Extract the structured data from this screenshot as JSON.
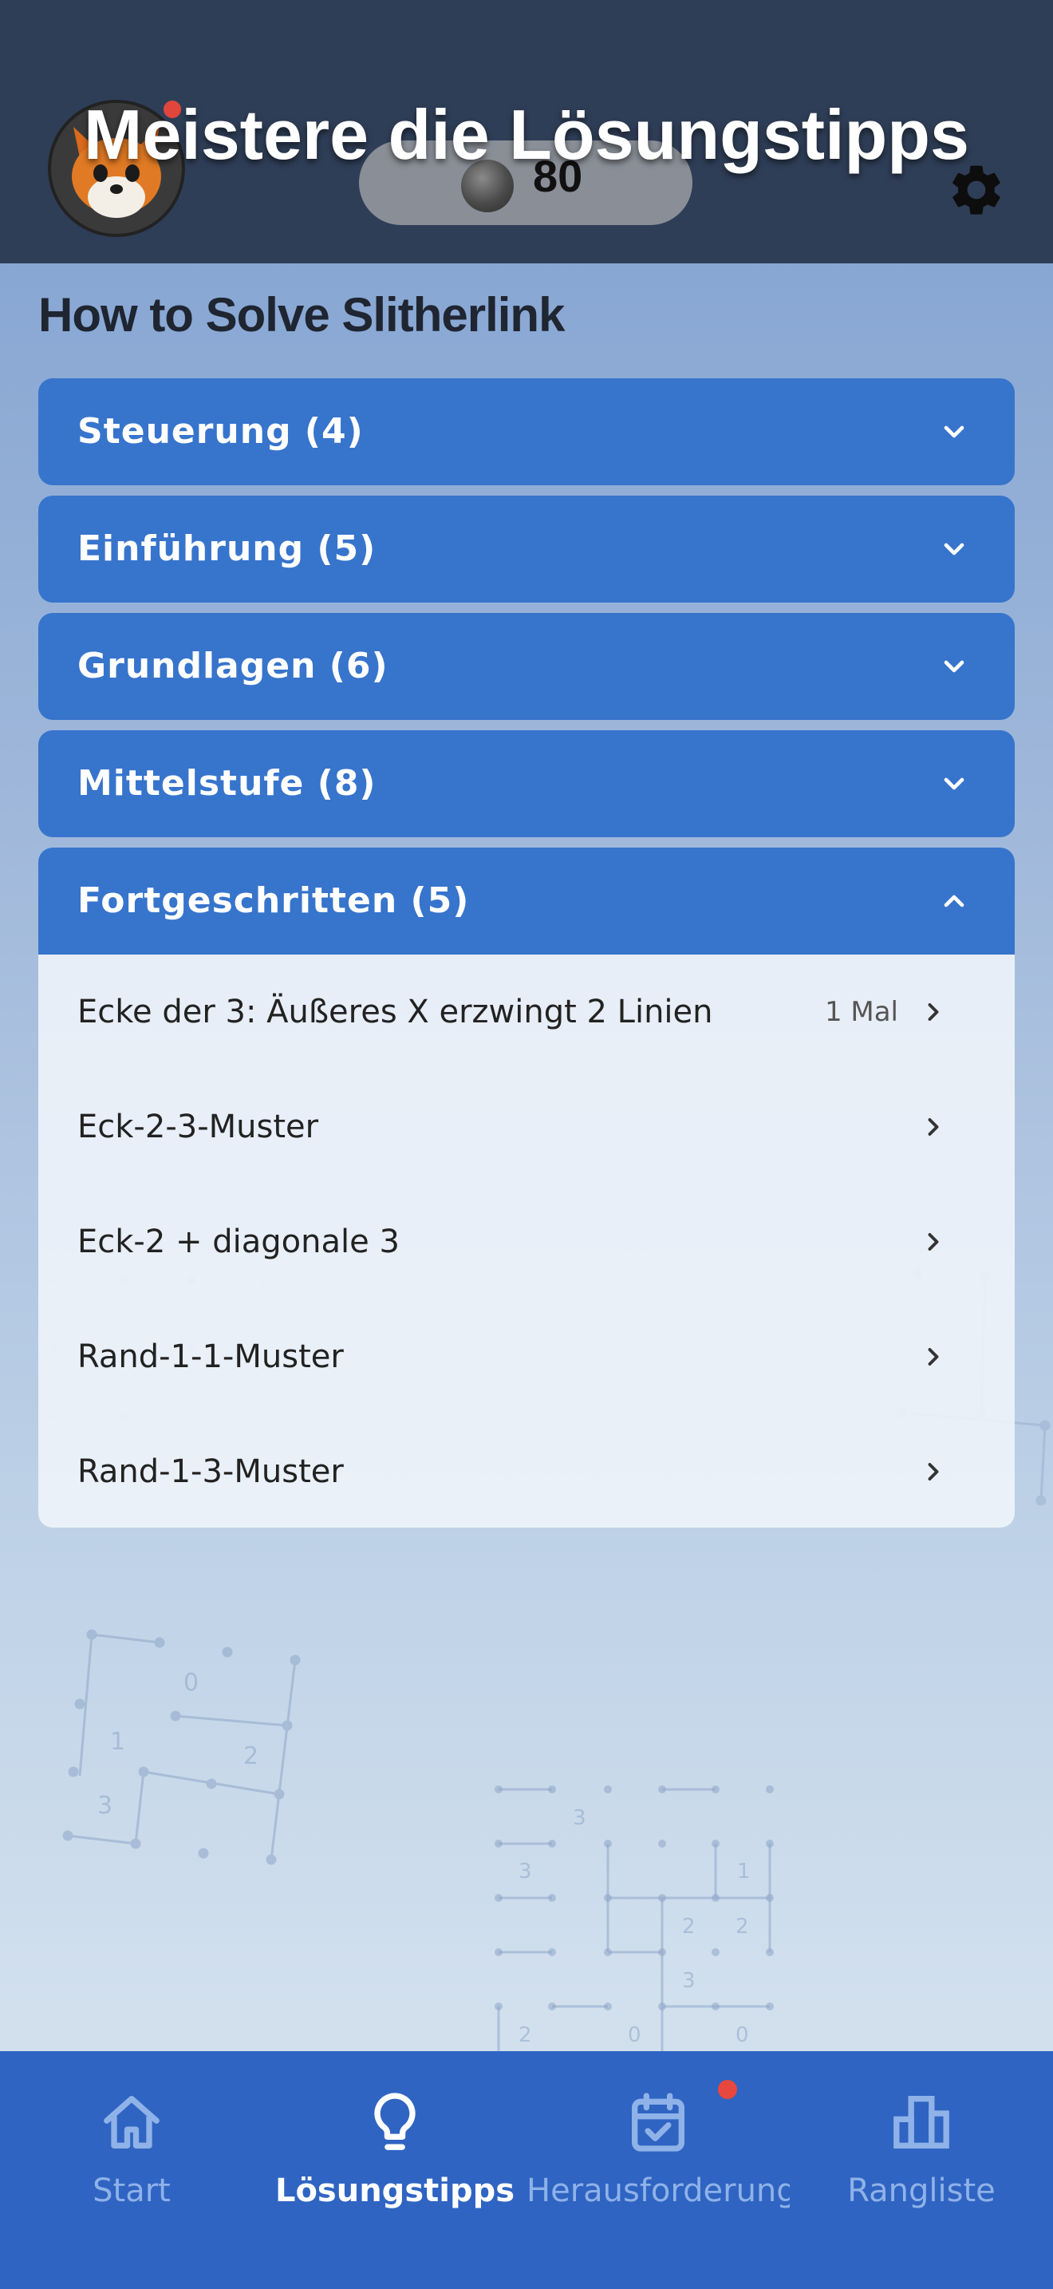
{
  "header": {
    "title": "Meistere die Lösungstipps",
    "coins": "80",
    "avatar_icon": "fox-avatar-icon",
    "settings_icon": "gear-icon"
  },
  "page": {
    "heading": "How to Solve Slitherlink"
  },
  "sections": [
    {
      "label": "Steuerung (4)",
      "expanded": false
    },
    {
      "label": "Einführung (5)",
      "expanded": false
    },
    {
      "label": "Grundlagen (6)",
      "expanded": false
    },
    {
      "label": "Mittelstufe (8)",
      "expanded": false
    },
    {
      "label": "Fortgeschritten (5)",
      "expanded": true
    }
  ],
  "advanced_items": [
    {
      "label": "Ecke der 3: Äußeres X erzwingt 2 Linien",
      "count": "1 Mal"
    },
    {
      "label": "Eck-2-3-Muster",
      "count": ""
    },
    {
      "label": "Eck-2 + diagonale 3",
      "count": ""
    },
    {
      "label": "Rand-1-1-Muster",
      "count": ""
    },
    {
      "label": "Rand-1-3-Muster",
      "count": ""
    }
  ],
  "nav": [
    {
      "label": "Start",
      "icon": "home-icon",
      "active": false
    },
    {
      "label": "Lösungstipps",
      "icon": "lightbulb-icon",
      "active": true
    },
    {
      "label": "Herausforderungen",
      "icon": "calendar-check-icon",
      "active": false
    },
    {
      "label": "Rangliste",
      "icon": "bar-chart-icon",
      "active": false
    }
  ],
  "colors": {
    "header_bg": "#2f3e57",
    "section_bg": "#3774cc",
    "nav_bg": "#2f64c2",
    "badge": "#e8473d"
  }
}
